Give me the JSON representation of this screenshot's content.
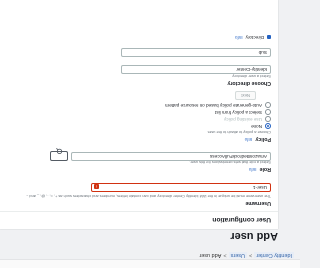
{
  "breadcrumb": {
    "items": [
      "Identity Center",
      "Users",
      "Add user"
    ],
    "separator": ">"
  },
  "page": {
    "title": "Add user"
  },
  "panel": {
    "title": "User configuration",
    "username": {
      "label": "Username",
      "description": "The username must be unique in the IAM Identity Center directory and can contain letters, numbers and characters such as +, =, ., @, _ and -.",
      "value": "User-1"
    },
    "role": {
      "label": "Role",
      "info": "Info",
      "description": "Select a role that sets permissions for this user.",
      "value": "AmazonBedrockFullAccess"
    },
    "policy": {
      "label": "Policy",
      "info": "Info",
      "description": "Choose a policy to attach to the user.",
      "options": [
        "None",
        "Use existing policy",
        "Select a policy from list",
        "Auto-generate policy based on resource pattern"
      ],
      "selected_index": 0,
      "button_label": "Next"
    },
    "group": {
      "label": "Choose directory",
      "description": "Select a user directory",
      "value": "Identity-Center",
      "value2": "Sub"
    },
    "checkbox": {
      "label": "Directory",
      "info": "Info",
      "checked": true
    }
  },
  "colors": {
    "accent": "#2462c2",
    "error": "#d13212",
    "text": "#16191f"
  }
}
